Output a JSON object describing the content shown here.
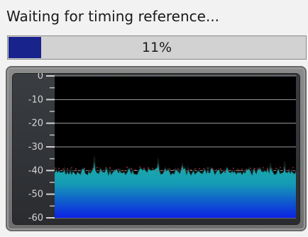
{
  "status": {
    "text": "Waiting for timing reference..."
  },
  "progress": {
    "percent": 11,
    "label": "11%",
    "fill_color": "#19238c"
  },
  "meter": {
    "scale_labels": [
      "0",
      "-10",
      "-20",
      "-30",
      "-40",
      "-50",
      "-60"
    ],
    "ylim": [
      -60,
      0
    ],
    "grid": true,
    "noise_floor_level": -40,
    "colors": {
      "background": "#000000",
      "fill_top": "#1fb3a5",
      "fill_bottom": "#0b22e8",
      "trace_color": "#111111",
      "peak_color": "#c43a3a",
      "gridline_color": "#cfcfcf",
      "scale_text": "#d4d4d4"
    }
  }
}
